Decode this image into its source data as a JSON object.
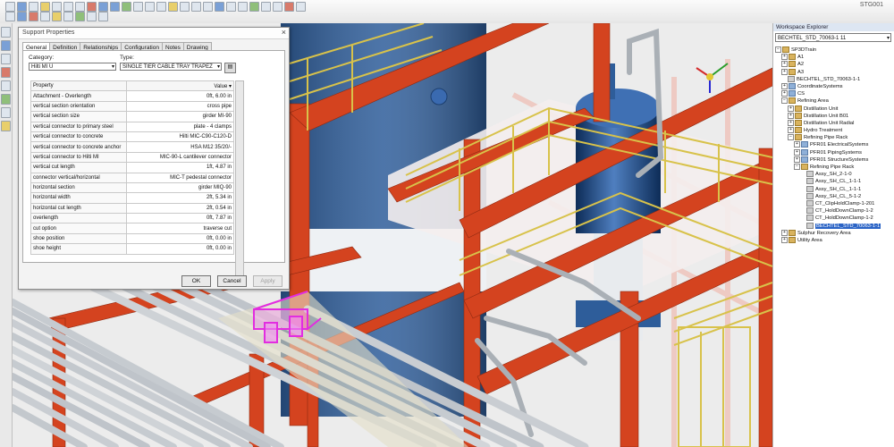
{
  "window": {
    "label": "STG001"
  },
  "dialog": {
    "title": "Support Properties",
    "close": "×",
    "tabs": [
      "General",
      "Definition",
      "Relationships",
      "Configuration",
      "Notes",
      "Drawing"
    ],
    "category_label": "Category:",
    "category_value": "Hilti MI U",
    "type_label": "Type:",
    "type_value": "SINGLE TIER CABLE TRAY TRAPEZ",
    "grid_headers": {
      "property": "Property",
      "value": "Value"
    },
    "rows": [
      {
        "p": "Attachment - Overlength",
        "v": "0ft, 6.00 in"
      },
      {
        "p": "vertical section orientation",
        "v": "cross pipe"
      },
      {
        "p": "vertical section size",
        "v": "girder MI-90"
      },
      {
        "p": "vertical connector to primary steel",
        "v": "plate - 4 clamps"
      },
      {
        "p": "vertical connector to concrete",
        "v": "Hilti MIC-C90-C120-D"
      },
      {
        "p": "vertical connector to concrete anchor",
        "v": "HSA M12 35/20/-"
      },
      {
        "p": "vertical connector to Hilti MI",
        "v": "MIC-90-L cantilever connector"
      },
      {
        "p": "vertical cut length",
        "v": "1ft, 4.87 in"
      },
      {
        "p": "connector vertical/horizontal",
        "v": "MIC-T pedestal connector"
      },
      {
        "p": "horizontal section",
        "v": "girder MIQ-90"
      },
      {
        "p": "horizontal width",
        "v": "2ft, 5.34 in"
      },
      {
        "p": "horizontal cut length",
        "v": "2ft, 0.54 in"
      },
      {
        "p": "overlength",
        "v": "0ft, 7.87 in"
      },
      {
        "p": "cut option",
        "v": "traverse cut"
      },
      {
        "p": "shoe position",
        "v": "0ft, 0.00 in"
      },
      {
        "p": "shoe height",
        "v": "0ft, 0.00 in"
      }
    ],
    "buttons": {
      "ok": "OK",
      "cancel": "Cancel",
      "apply": "Apply"
    }
  },
  "explorer": {
    "title": "Workspace Explorer",
    "combo": "BECHTEL_STD_70063-1 11",
    "nodes": [
      {
        "label": "SP3DTrain",
        "icon": "folder-icon",
        "exp": "−",
        "sel": false
      },
      {
        "label": "A1",
        "icon": "folder-icon",
        "exp": "+",
        "sel": false
      },
      {
        "label": "A2",
        "icon": "folder-icon",
        "exp": "+",
        "sel": false
      },
      {
        "label": "A3",
        "icon": "folder-icon",
        "exp": "+",
        "sel": false
      },
      {
        "label": "BECHTEL_STD_70063-1-1",
        "icon": "part-icon",
        "exp": "",
        "sel": false
      },
      {
        "label": "CoordinateSystems",
        "icon": "system-icon",
        "exp": "+",
        "sel": false
      },
      {
        "label": "CS",
        "icon": "system-icon",
        "exp": "+",
        "sel": false
      },
      {
        "label": "Refining Area",
        "icon": "folder-icon",
        "exp": "−",
        "sel": false
      },
      {
        "label": "Distillation Unit",
        "icon": "folder-icon",
        "exp": "+",
        "sel": false
      },
      {
        "label": "Distillation Unit B01",
        "icon": "folder-icon",
        "exp": "+",
        "sel": false
      },
      {
        "label": "Distillation Unit Radial",
        "icon": "folder-icon",
        "exp": "+",
        "sel": false
      },
      {
        "label": "Hydro Treatment",
        "icon": "folder-icon",
        "exp": "+",
        "sel": false
      },
      {
        "label": "Refining Pipe Rack",
        "icon": "folder-icon",
        "exp": "−",
        "sel": false
      },
      {
        "label": "PFR01 ElectricalSystems",
        "icon": "system-icon",
        "exp": "+",
        "sel": false
      },
      {
        "label": "PFR01 PipingSystems",
        "icon": "system-icon",
        "exp": "+",
        "sel": false
      },
      {
        "label": "PFR01 StructureSystems",
        "icon": "system-icon",
        "exp": "+",
        "sel": false
      },
      {
        "label": "Refining Pipe Rack",
        "icon": "folder-icon",
        "exp": "−",
        "sel": false
      },
      {
        "label": "Assy_SH_2-1-0",
        "icon": "part-icon",
        "exp": "",
        "sel": false
      },
      {
        "label": "Assy_SH_CL_1-1-1",
        "icon": "part-icon",
        "exp": "",
        "sel": false
      },
      {
        "label": "Assy_SH_CL_1-1-1",
        "icon": "part-icon",
        "exp": "",
        "sel": false
      },
      {
        "label": "Assy_SH_CL_5-1-2",
        "icon": "part-icon",
        "exp": "",
        "sel": false
      },
      {
        "label": "CT_ClipHoldClamp-1-201",
        "icon": "part-icon",
        "exp": "",
        "sel": false
      },
      {
        "label": "CT_HoldDownClamp-1-2",
        "icon": "part-icon",
        "exp": "",
        "sel": false
      },
      {
        "label": "CT_HoldDownClamp-1-2",
        "icon": "part-icon",
        "exp": "",
        "sel": false
      },
      {
        "label": "BECHTEL_STD_70063-1-1",
        "icon": "part-icon",
        "exp": "",
        "sel": true
      },
      {
        "label": "Sulphur Recovery Area",
        "icon": "folder-icon",
        "exp": "+",
        "sel": false
      },
      {
        "label": "Utility Area",
        "icon": "folder-icon",
        "exp": "+",
        "sel": false
      }
    ]
  },
  "colors": {
    "steel_red": "#d4431f",
    "vessel_blue": "#2e5d9a",
    "railing_yellow": "#d8c24a",
    "pipe_grey": "#c9cdd2",
    "support_magenta": "#e22de0",
    "selection_blue": "#2b64c6"
  }
}
